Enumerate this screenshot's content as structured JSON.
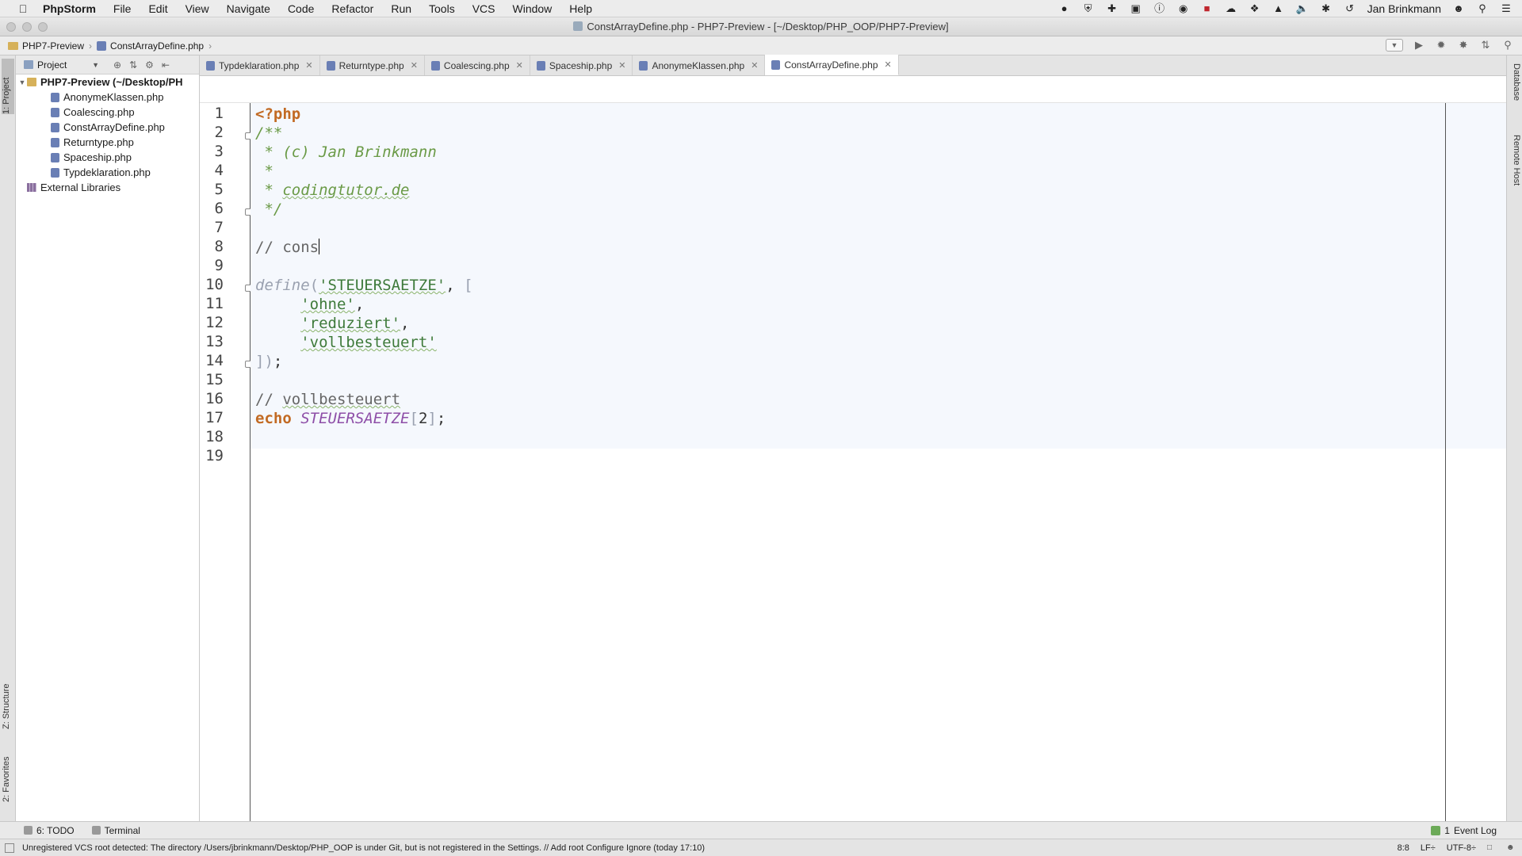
{
  "menubar": {
    "app_name": "PhpStorm",
    "items": [
      "File",
      "Edit",
      "View",
      "Navigate",
      "Code",
      "Refactor",
      "Run",
      "Tools",
      "VCS",
      "Window",
      "Help"
    ],
    "user": "Jan Brinkmann"
  },
  "window": {
    "title": "ConstArrayDefine.php - PHP7-Preview - [~/Desktop/PHP_OOP/PHP7-Preview]"
  },
  "navbar": {
    "project": "PHP7-Preview",
    "file": "ConstArrayDefine.php"
  },
  "left_stripe": {
    "project_tab": "1: Project",
    "structure_tab": "Z: Structure",
    "favorites_tab": "2: Favorites"
  },
  "right_stripe": {
    "database_tab": "Database",
    "remote_host_tab": "Remote Host"
  },
  "project_panel": {
    "view_selector": "Project",
    "root": "PHP7-Preview (~/Desktop/PH",
    "files": [
      "AnonymeKlassen.php",
      "Coalescing.php",
      "ConstArrayDefine.php",
      "Returntype.php",
      "Spaceship.php",
      "Typdeklaration.php"
    ],
    "external": "External Libraries"
  },
  "tabs": [
    {
      "label": "Typdeklaration.php",
      "active": false
    },
    {
      "label": "Returntype.php",
      "active": false
    },
    {
      "label": "Coalescing.php",
      "active": false
    },
    {
      "label": "Spaceship.php",
      "active": false
    },
    {
      "label": "AnonymeKlassen.php",
      "active": false
    },
    {
      "label": "ConstArrayDefine.php",
      "active": true
    }
  ],
  "editor": {
    "line_numbers": [
      "1",
      "2",
      "3",
      "4",
      "5",
      "6",
      "7",
      "8",
      "9",
      "10",
      "11",
      "12",
      "13",
      "14",
      "15",
      "16",
      "17",
      "18",
      "19"
    ],
    "code": {
      "php_open": "<?php",
      "doc_open": "/**",
      "doc_star": " * ",
      "doc_c": "(c) ",
      "doc_author": "Jan Brinkmann",
      "doc_star_only": " *",
      "doc_site": "codingtutor.de",
      "doc_close": " */",
      "line8_comment": "// cons",
      "define_kw": "define",
      "paren_open": "(",
      "const_name": "'STEUERSAETZE'",
      "comma_bracket": ", ",
      "bracket_open": "[",
      "indent": "     ",
      "item1": "'ohne'",
      "item2": "'reduziert'",
      "item3": "'vollbesteuert'",
      "comma": ",",
      "bracket_close": "]",
      "paren_close": ")",
      "semicolon": ";",
      "line16_prefix": "// ",
      "line16_word": "vollbesteuert",
      "echo_kw": "echo",
      "space": " ",
      "const_ref": "STEUERSAETZE",
      "idx_open": "[",
      "idx": "2",
      "idx_close": "]"
    }
  },
  "bottom_tools": {
    "todo": "6: TODO",
    "terminal": "Terminal",
    "event_log": "Event Log",
    "event_count": "1"
  },
  "statusbar": {
    "message": "Unregistered VCS root detected: The directory /Users/jbrinkmann/Desktop/PHP_OOP is under Git, but is not registered in the Settings. // Add root  Configure  Ignore (today 17:10)",
    "position": "8:8",
    "line_sep": "LF÷",
    "encoding": "UTF-8÷"
  },
  "colors": {
    "keyword": "#c26a23",
    "comment": "#6a9a46",
    "string": "#3e7a3a",
    "constant": "#8e4fa8"
  }
}
